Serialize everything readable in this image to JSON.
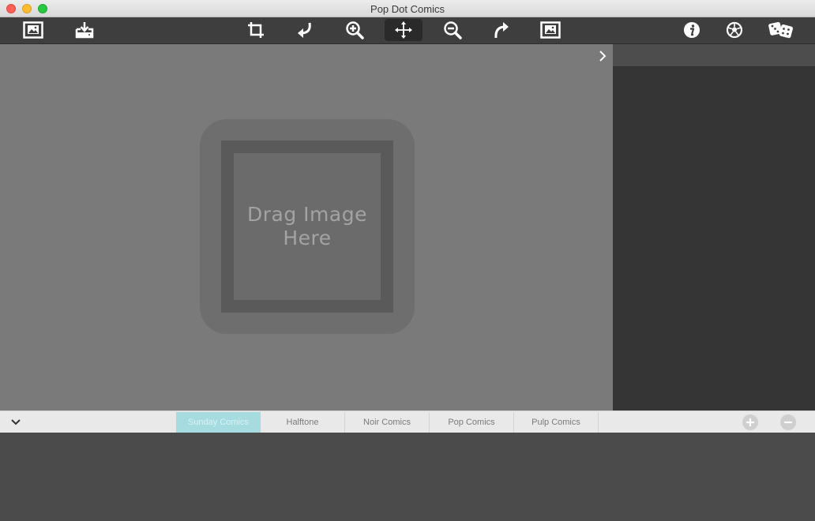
{
  "window": {
    "title": "Pop Dot Comics"
  },
  "toolbar": {
    "left": [
      {
        "icon": "open-image-icon"
      },
      {
        "icon": "save-to-disk-icon"
      }
    ],
    "center": [
      {
        "icon": "crop-icon"
      },
      {
        "icon": "rotate-left-icon"
      },
      {
        "icon": "zoom-in-icon"
      },
      {
        "icon": "move-icon",
        "active": true
      },
      {
        "icon": "zoom-out-icon"
      },
      {
        "icon": "rotate-right-icon"
      },
      {
        "icon": "fit-image-icon"
      }
    ],
    "right": [
      {
        "icon": "info-icon"
      },
      {
        "icon": "soccer-ball-icon"
      },
      {
        "icon": "dice-icon"
      }
    ]
  },
  "canvas": {
    "drop_zone_text": "Drag Image Here"
  },
  "tabs": [
    {
      "label": "Sunday Comics",
      "selected": true
    },
    {
      "label": "Halftone",
      "selected": false
    },
    {
      "label": "Noir Comics",
      "selected": false
    },
    {
      "label": "Pop Comics",
      "selected": false
    },
    {
      "label": "Pulp Comics",
      "selected": false
    }
  ],
  "colors": {
    "selected_tab": "#a6dbe0",
    "canvas_bg": "#7a7a7a",
    "toolbar_bg": "#3e3e3e"
  }
}
